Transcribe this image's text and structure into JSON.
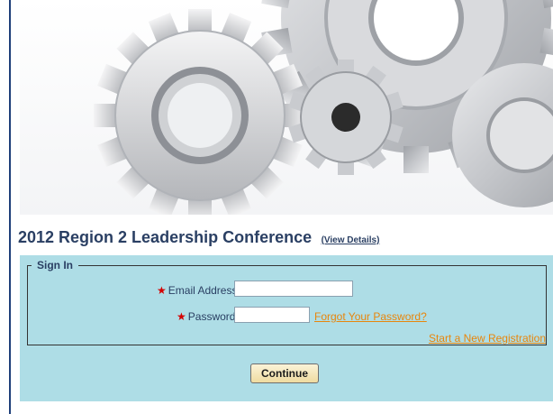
{
  "hero": {
    "image": "gears-image"
  },
  "conference": {
    "title": "2012 Region 2 Leadership Conference",
    "view_details": "(View Details)"
  },
  "signin": {
    "legend": "Sign In",
    "email_label": "Email Address:",
    "email_value": "",
    "password_label": "Password:",
    "password_value": "",
    "required_marker": "★",
    "forgot_password": "Forgot Your Password?",
    "new_registration": "Start a New Registration",
    "continue_label": "Continue"
  },
  "colors": {
    "title": "#2a3f63",
    "panel_bg": "#aedde6",
    "link": "#e8860c",
    "required": "#d40000"
  }
}
